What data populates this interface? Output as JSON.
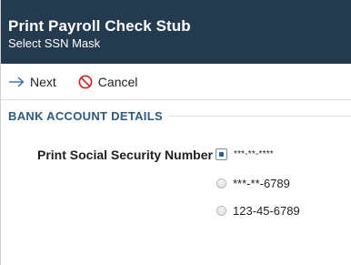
{
  "header": {
    "title": "Print Payroll Check Stub",
    "subtitle": "Select SSN Mask"
  },
  "toolbar": {
    "next_label": "Next",
    "cancel_label": "Cancel",
    "next_icon": "arrow-right-icon",
    "cancel_icon": "prohibited-icon",
    "next_icon_color": "#3c6fae",
    "cancel_icon_color": "#cc1f1f"
  },
  "section": {
    "title": "BANK ACCOUNT DETAILS"
  },
  "ssn_field": {
    "label": "Print Social Security Number",
    "options": [
      {
        "label": "***-**-****",
        "selected": true
      },
      {
        "label": "***-**-6789",
        "selected": false
      },
      {
        "label": "123-45-6789",
        "selected": false
      }
    ]
  },
  "colors": {
    "titlebar_bg": "#233a4f",
    "section_title": "#2c5a83"
  }
}
